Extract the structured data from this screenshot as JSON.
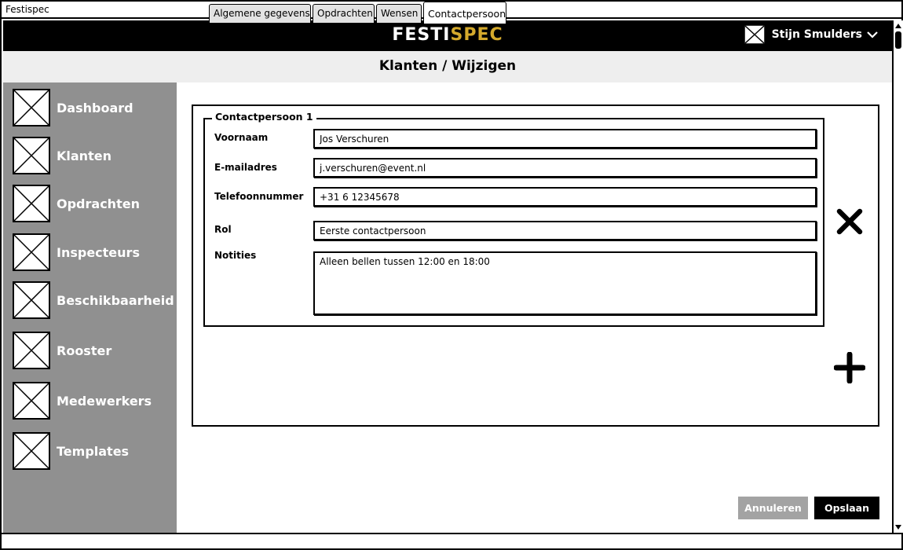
{
  "window": {
    "title": "Festispec"
  },
  "header": {
    "logo_part1": "FESTI",
    "logo_part2": "SPEC",
    "user_name": "Stijn Smulders",
    "accent_color": "#d4a92c"
  },
  "page": {
    "title": "Klanten / Wijzigen"
  },
  "sidebar": {
    "items": [
      {
        "label": "Dashboard"
      },
      {
        "label": "Klanten"
      },
      {
        "label": "Opdrachten"
      },
      {
        "label": "Inspecteurs"
      },
      {
        "label": "Beschikbaarheid"
      },
      {
        "label": "Rooster"
      },
      {
        "label": "Medewerkers"
      },
      {
        "label": "Templates"
      }
    ]
  },
  "tabs": [
    {
      "label": "Algemene gegevens",
      "active": false
    },
    {
      "label": "Opdrachten",
      "active": false
    },
    {
      "label": "Wensen",
      "active": false
    },
    {
      "label": "Contactpersoon",
      "active": true
    }
  ],
  "contact": {
    "group_title": "Contactpersoon 1",
    "fields": {
      "voornaam": {
        "label": "Voornaam",
        "value": "Jos Verschuren"
      },
      "email": {
        "label": "E-mailadres",
        "value": "j.verschuren@event.nl"
      },
      "telefoon": {
        "label": "Telefoonnummer",
        "value": "+31 6 12345678"
      },
      "rol": {
        "label": "Rol",
        "value": "Eerste contactpersoon"
      },
      "notities": {
        "label": "Notities",
        "value": "Alleen bellen tussen 12:00 en 18:00"
      }
    }
  },
  "actions": {
    "cancel_label": "Annuleren",
    "save_label": "Opslaan"
  },
  "icons": {
    "remove": "close-icon",
    "add": "plus-icon",
    "user": "image-placeholder-icon",
    "dropdown": "chevron-down-icon"
  }
}
